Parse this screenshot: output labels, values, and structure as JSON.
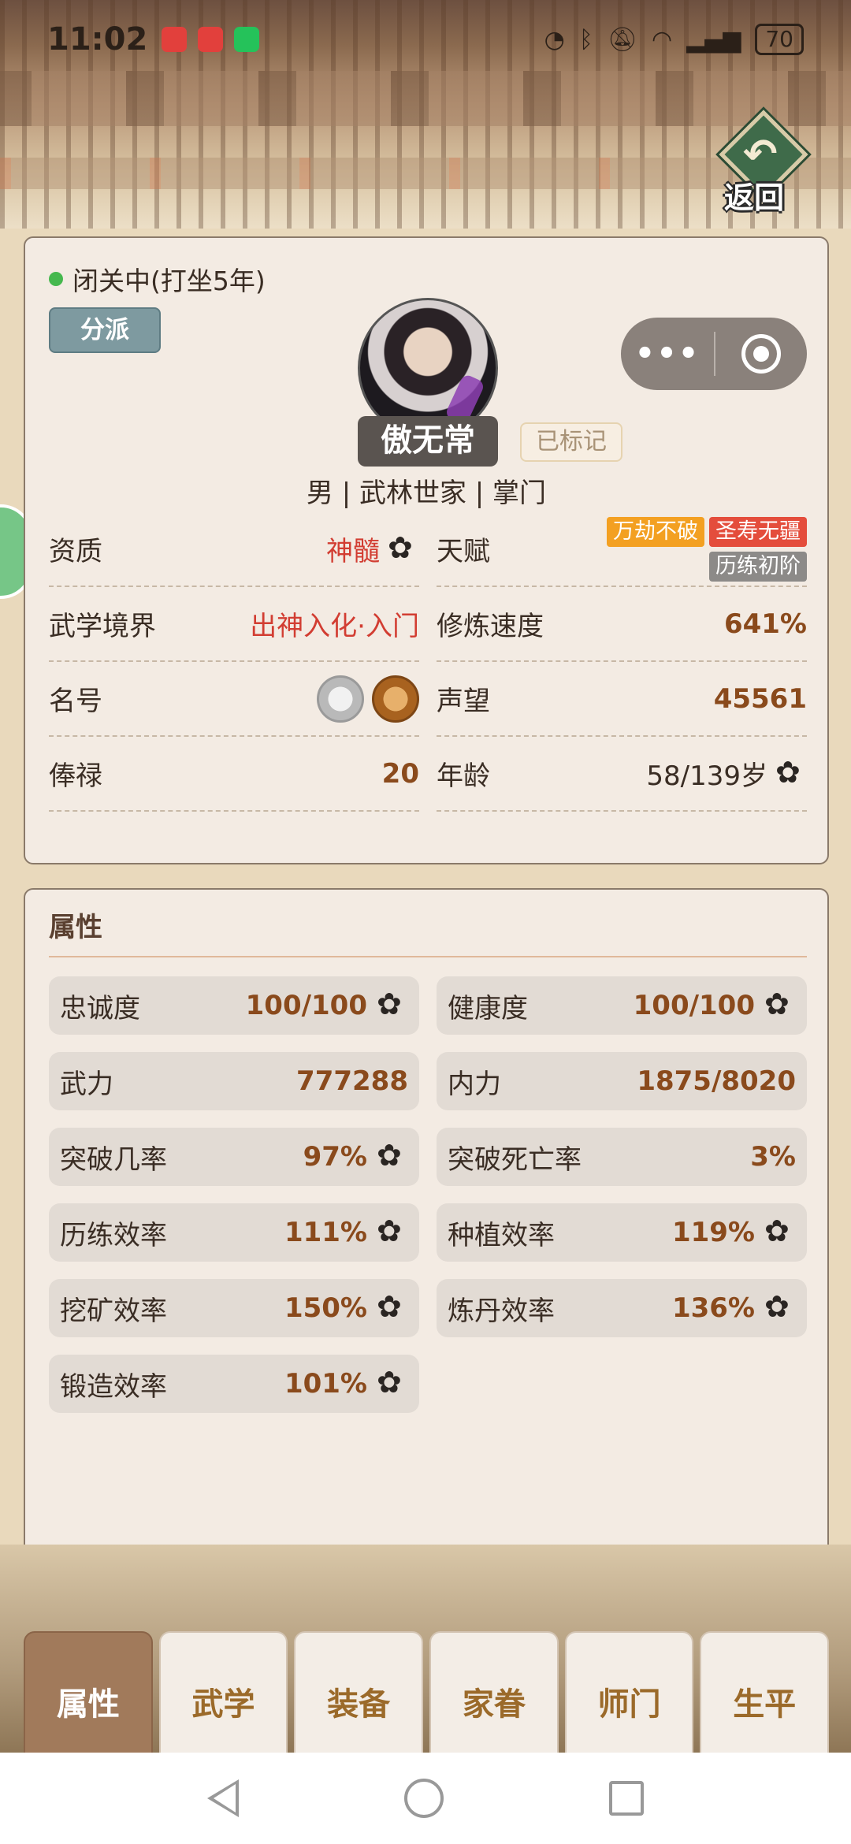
{
  "status_bar": {
    "time": "11:02",
    "battery": "70"
  },
  "back_button": {
    "label": "返回"
  },
  "capsule": {
    "more": "•••"
  },
  "profile": {
    "status": "闭关中(打坐5年)",
    "branch_button": "分派",
    "name": "傲无常",
    "marked_label": "已标记",
    "bio": "男  |  武林世家  |  掌门"
  },
  "info": {
    "aptitude_label": "资质",
    "aptitude_value": "神髓",
    "talent_label": "天赋",
    "talents": [
      "万劫不破",
      "圣寿无疆",
      "历练初阶"
    ],
    "realm_label": "武学境界",
    "realm_value": "出神入化·入门",
    "speed_label": "修炼速度",
    "speed_value": "641%",
    "title_label": "名号",
    "fame_label": "声望",
    "fame_value": "45561",
    "salary_label": "俸禄",
    "salary_value": "20",
    "age_label": "年龄",
    "age_value": "58/139岁"
  },
  "attributes": {
    "heading": "属性",
    "items": [
      {
        "label": "忠诚度",
        "value": "100/100"
      },
      {
        "label": "健康度",
        "value": "100/100"
      },
      {
        "label": "武力",
        "value": "777288"
      },
      {
        "label": "内力",
        "value": "1875/8020"
      },
      {
        "label": "突破几率",
        "value": "97%"
      },
      {
        "label": "突破死亡率",
        "value": "3%"
      },
      {
        "label": "历练效率",
        "value": "111%"
      },
      {
        "label": "种植效率",
        "value": "119%"
      },
      {
        "label": "挖矿效率",
        "value": "150%"
      },
      {
        "label": "炼丹效率",
        "value": "136%"
      },
      {
        "label": "锻造效率",
        "value": "101%"
      }
    ]
  },
  "tabs": [
    "属性",
    "武学",
    "装备",
    "家眷",
    "师门",
    "生平"
  ],
  "colors": {
    "accent": "#a17a5b",
    "value_brown": "#8a4a1c",
    "value_red": "#d23d32",
    "status_green": "#46b84e"
  }
}
